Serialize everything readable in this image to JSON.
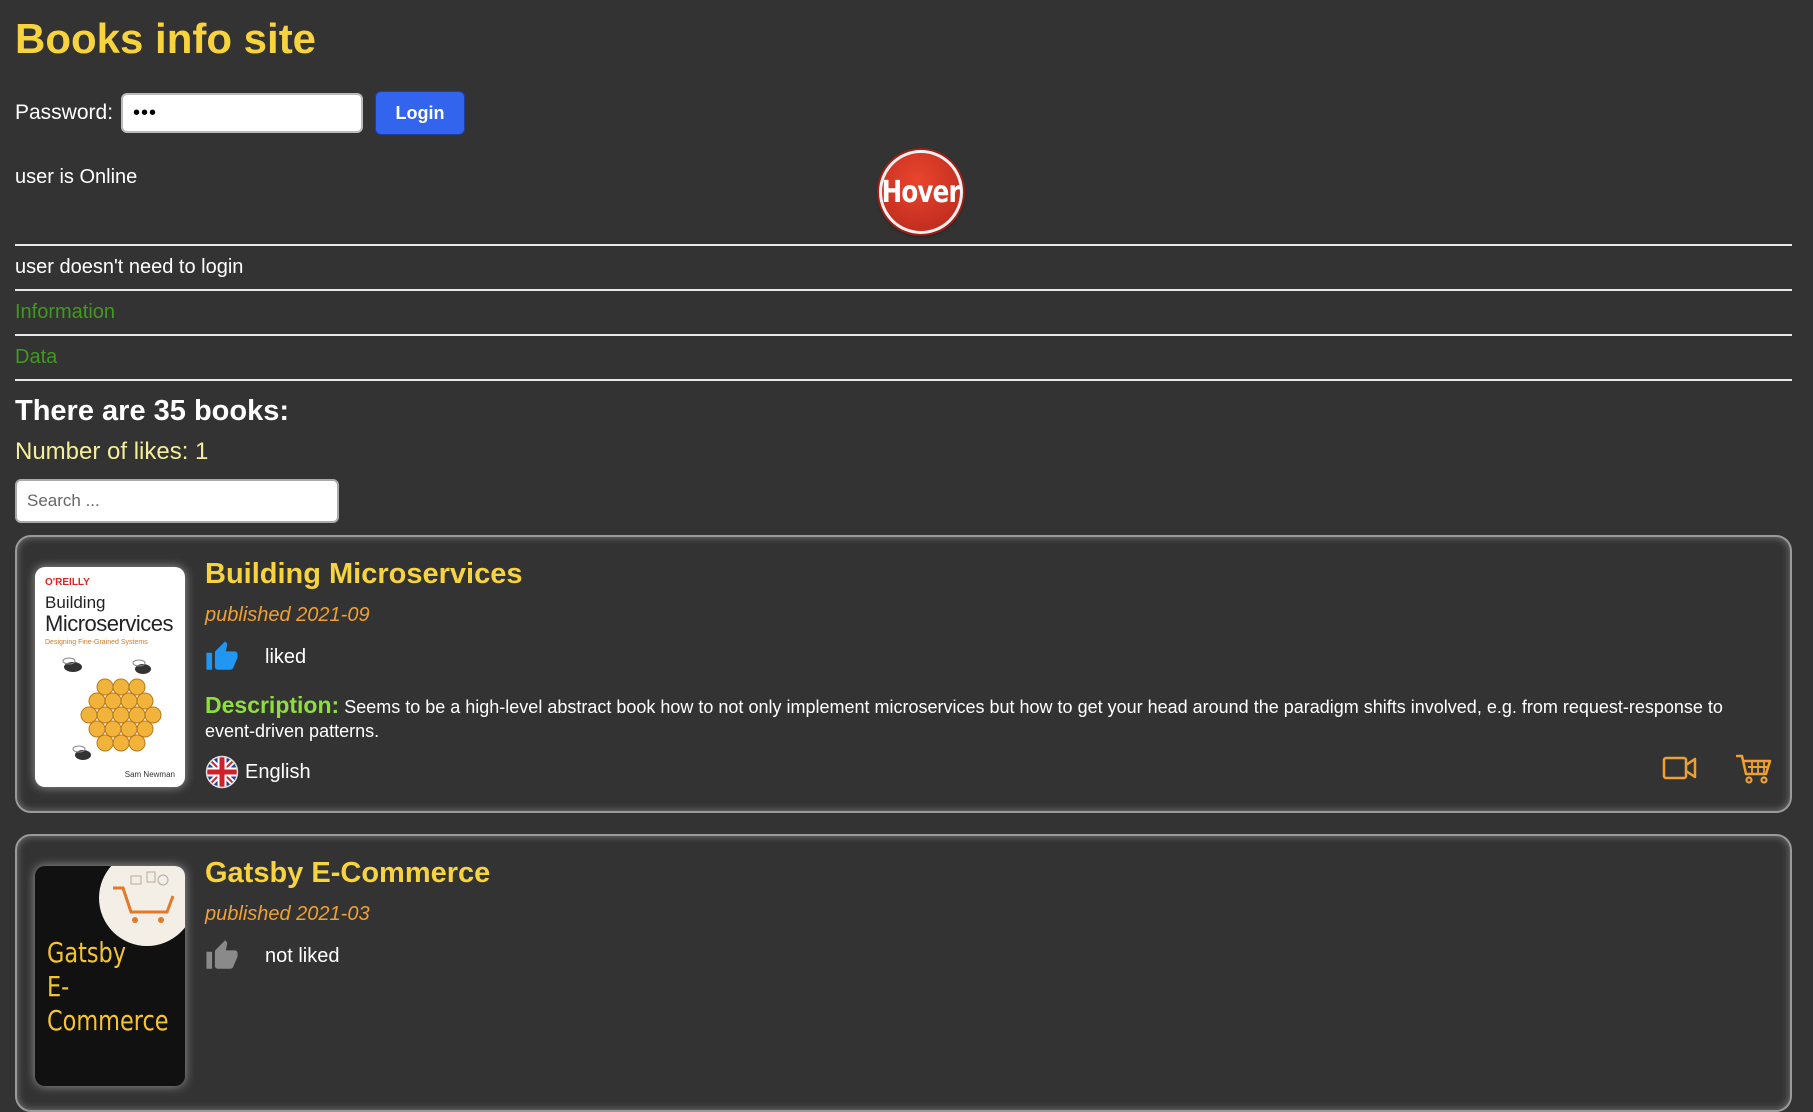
{
  "header": {
    "title": "Books info site"
  },
  "login": {
    "password_label": "Password:",
    "password_value": "•••",
    "login_button": "Login"
  },
  "status": {
    "online_text": "user is Online",
    "hover_button": "Hover",
    "login_note": "user doesn't need to login"
  },
  "nav": {
    "information": "Information",
    "data": "Data"
  },
  "summary": {
    "book_count_heading": "There are 35 books:",
    "likes_count": "Number of likes: 1"
  },
  "search": {
    "placeholder": "Search ..."
  },
  "books": [
    {
      "title": "Building Microservices",
      "published": "published 2021-09",
      "like_status": "liked",
      "like_icon": "thumbs-up-icon",
      "like_color": "#2196f3",
      "description_label": "Description:",
      "description": "Seems to be a high-level abstract book how to not only implement microservices but how to get your head around the paradigm shifts involved, e.g. from request-response to event-driven patterns.",
      "language": "English",
      "language_icon": "uk-flag-icon",
      "cover": {
        "publisher": "O'REILLY",
        "title_line1": "Building",
        "title_line2": "Microservices",
        "subtitle": "Designing Fine-Grained Systems",
        "author": "Sam Newman"
      },
      "actions": [
        "video-icon",
        "cart-icon"
      ]
    },
    {
      "title": "Gatsby E-Commerce",
      "published": "published 2021-03",
      "like_status": "not liked",
      "like_icon": "thumbs-up-icon",
      "like_color": "#8a8a8a",
      "cover": {
        "title_line1": "Gatsby",
        "title_line2": "E-Commerce"
      }
    }
  ],
  "colors": {
    "background": "#333333",
    "title": "#f7d33f",
    "accent_button": "#3264ee",
    "link_green": "#3f9a1f",
    "published_orange": "#f0a030",
    "description_label": "#8ddf3e",
    "action_icon": "#f0a030"
  }
}
